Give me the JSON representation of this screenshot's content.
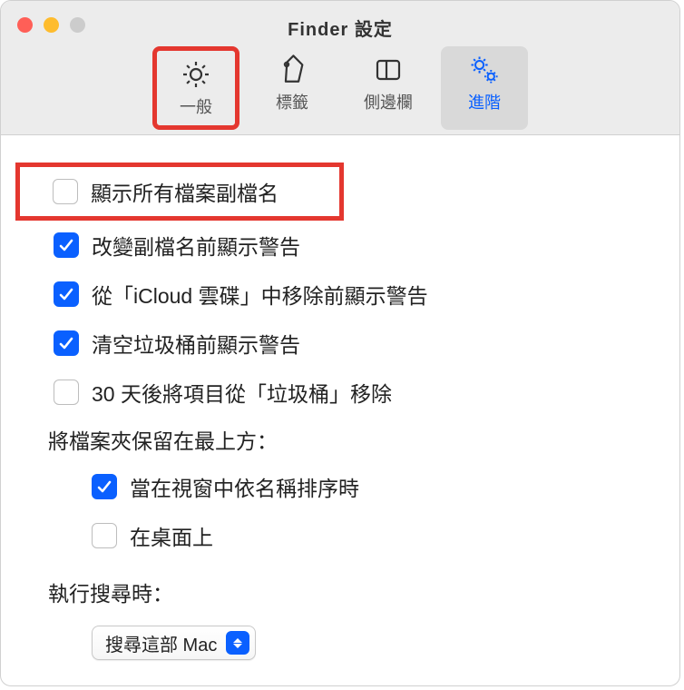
{
  "window": {
    "title": "Finder 設定"
  },
  "tabs": {
    "general": "一般",
    "tags": "標籤",
    "sidebar": "側邊欄",
    "advanced": "進階"
  },
  "options": {
    "showExtensions": "顯示所有檔案副檔名",
    "warnChangeExt": "改變副檔名前顯示警告",
    "warnRemoveICloud": "從「iCloud 雲碟」中移除前顯示警告",
    "warnEmptyTrash": "清空垃圾桶前顯示警告",
    "remove30Days": "30 天後將項目從「垃圾桶」移除",
    "foldersOnTopLabel": "將檔案夾保留在最上方：",
    "sortByNameWindows": "當在視窗中依名稱排序時",
    "onDesktop": "在桌面上",
    "searchLabel": "執行搜尋時：",
    "searchOption": "搜尋這部 Mac"
  },
  "checks": {
    "showExtensions": false,
    "warnChangeExt": true,
    "warnRemoveICloud": true,
    "warnEmptyTrash": true,
    "remove30Days": false,
    "sortByNameWindows": true,
    "onDesktop": false
  }
}
